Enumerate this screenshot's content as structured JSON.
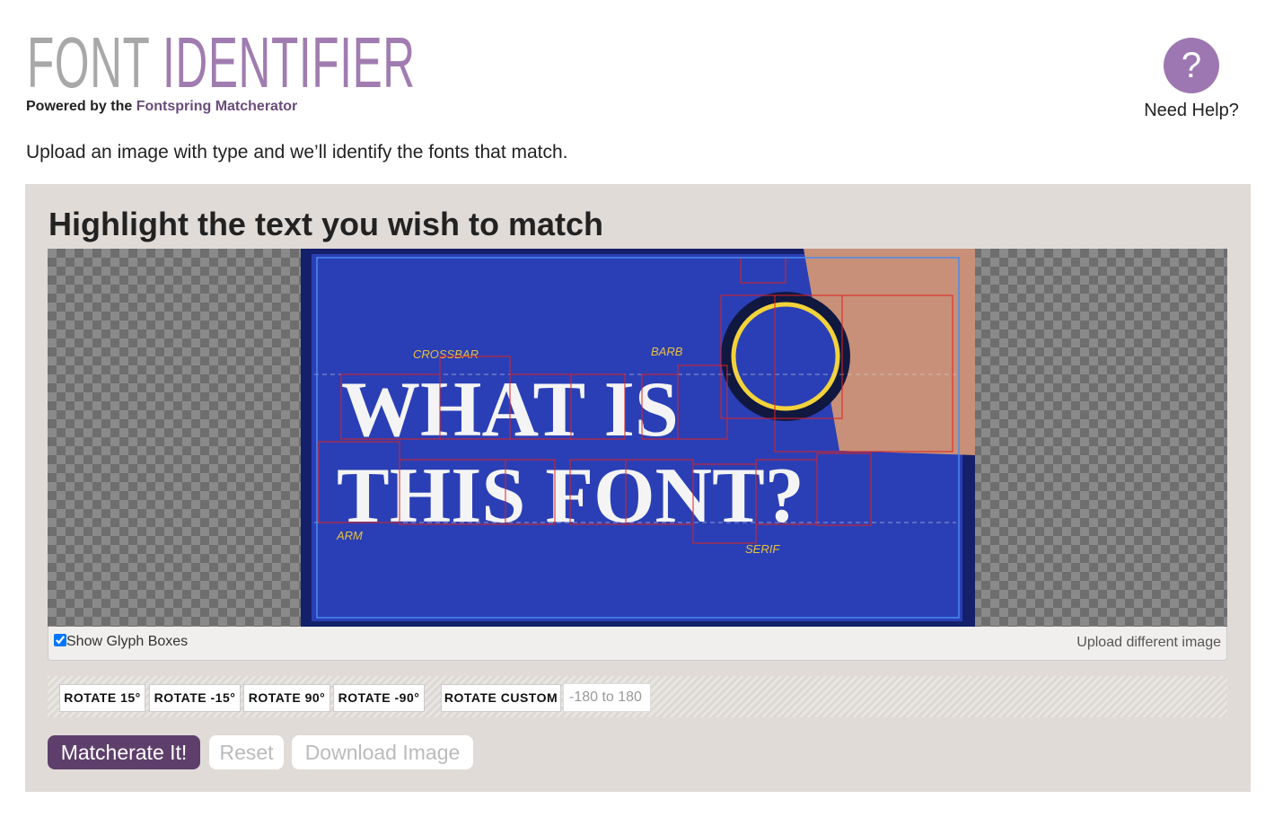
{
  "header": {
    "logo_part1": "FONT",
    "logo_part2": "IDENTIFIER",
    "powered_prefix": "Powered by the",
    "powered_link": "Fontspring Matcherator",
    "help_icon": "?",
    "help_label": "Need Help?"
  },
  "intro": "Upload an image with type and we’ll identify the fonts that match.",
  "panel": {
    "title": "Highlight the text you wish to match",
    "image_text": {
      "line1": "WHAT IS",
      "line2": "THIS FONT?",
      "annotations": [
        "CROSSBAR",
        "BARB",
        "ARM",
        "SERIF"
      ]
    },
    "show_glyph_boxes_label": "Show Glyph Boxes",
    "show_glyph_boxes_checked": true,
    "upload_different": "Upload different image",
    "rotate_buttons": [
      "ROTATE 15°",
      "ROTATE -15°",
      "ROTATE 90°",
      "ROTATE -90°"
    ],
    "rotate_custom": "ROTATE CUSTOM",
    "rotate_custom_placeholder": "-180 to 180",
    "matcherate": "Matcherate It!",
    "reset": "Reset",
    "download": "Download Image"
  },
  "colors": {
    "brand_purple": "#a07cb0",
    "button_purple": "#5e3f6b",
    "image_blue": "#2a3fb5"
  }
}
